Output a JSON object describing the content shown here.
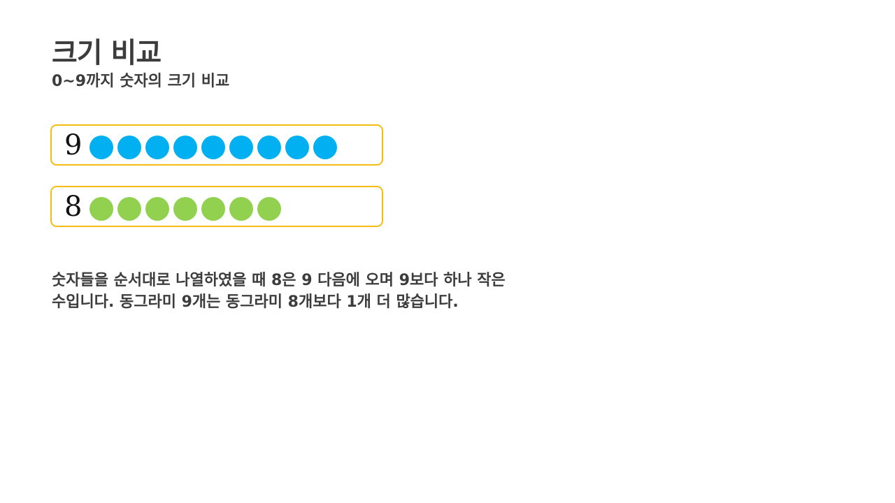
{
  "title": "크기 비교",
  "subtitle": "0~9까지 숫자의 크기 비교",
  "rows": [
    {
      "number": "9",
      "count": 9,
      "color": "#00b0f0"
    },
    {
      "number": "8",
      "count": 7,
      "color": "#92d050"
    }
  ],
  "description": {
    "line1": "숫자들을 순서대로 나열하였을 때 8은 9 다음에 오며 9보다 하나 작은",
    "line2": "수입니다. 동그라미 9개는 동그라미 8개보다 1개 더 많습니다."
  },
  "colors": {
    "border": "#f5bd14",
    "text": "#3c3c3c"
  }
}
